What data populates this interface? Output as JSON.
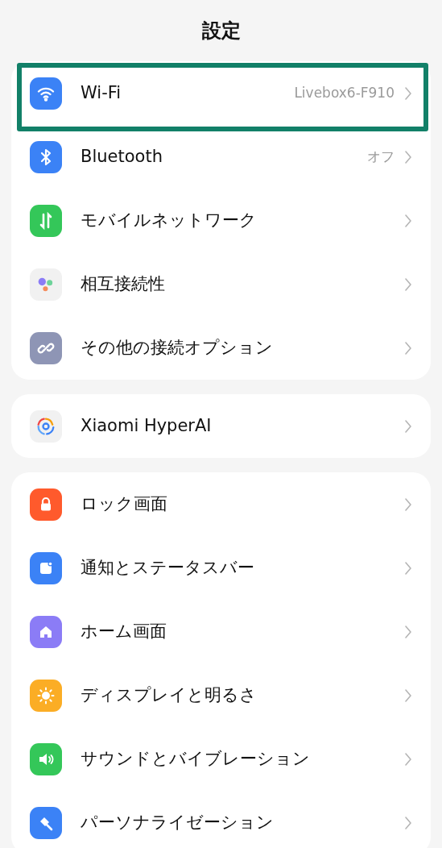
{
  "title": "設定",
  "groups": [
    {
      "items": [
        {
          "kind": "wifi",
          "label": "Wi-Fi",
          "value": "Livebox6-F910",
          "highlighted": true
        },
        {
          "kind": "bluetooth",
          "label": "Bluetooth",
          "value": "オフ",
          "highlighted": false
        },
        {
          "kind": "mobile",
          "label": "モバイルネットワーク",
          "highlighted": false
        },
        {
          "kind": "interconnect",
          "label": "相互接続性",
          "highlighted": false
        },
        {
          "kind": "link",
          "label": "その他の接続オプション",
          "highlighted": false
        }
      ]
    },
    {
      "items": [
        {
          "kind": "ai",
          "label": "Xiaomi HyperAI",
          "highlighted": false
        }
      ]
    },
    {
      "items": [
        {
          "kind": "lock",
          "label": "ロック画面",
          "highlighted": false
        },
        {
          "kind": "notification",
          "label": "通知とステータスバー",
          "highlighted": false
        },
        {
          "kind": "home",
          "label": "ホーム画面",
          "highlighted": false
        },
        {
          "kind": "display",
          "label": "ディスプレイと明るさ",
          "highlighted": false
        },
        {
          "kind": "sound",
          "label": "サウンドとバイブレーション",
          "highlighted": false
        },
        {
          "kind": "personalize",
          "label": "パーソナライゼーション",
          "highlighted": false
        }
      ]
    }
  ]
}
